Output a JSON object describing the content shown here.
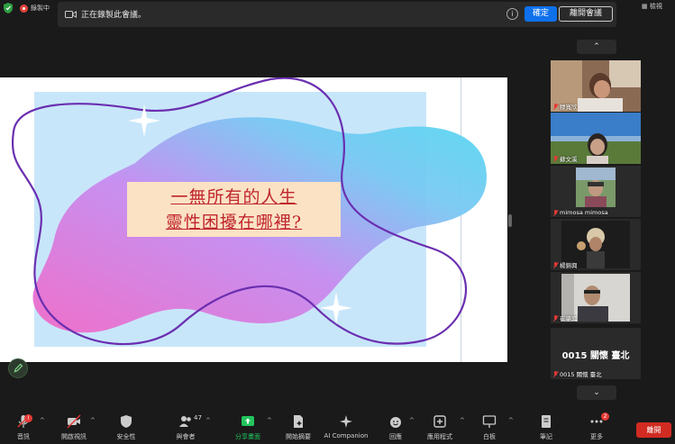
{
  "top": {
    "recording_label": "錄製中",
    "notice_text": "正在錄製此會議。",
    "ok_label": "確定",
    "leave_meeting_label": "離開會議",
    "view_label": "檢視"
  },
  "slide": {
    "title_line1": "一無所有的人生",
    "title_line2": "靈性困擾在哪裡?"
  },
  "gallery": {
    "tiles": [
      {
        "name": "穆寬欣"
      },
      {
        "name": "蘇文溪"
      },
      {
        "name": "mimosa mimosa"
      },
      {
        "name": "楊錦興"
      },
      {
        "name": "崔肇興"
      },
      {
        "name": "0015 關懷 臺北",
        "display_name": "0015 關懷 臺北"
      }
    ]
  },
  "toolbar": {
    "items": [
      {
        "label": "音訊",
        "icon": "mic-icon",
        "badge": "!"
      },
      {
        "label": "開啟視訊",
        "icon": "video-off-icon"
      },
      {
        "label": "安全性",
        "icon": "shield-icon"
      },
      {
        "label": "與會者",
        "icon": "participants-icon",
        "count": "47"
      },
      {
        "label": "分享畫面",
        "icon": "share-screen-icon"
      },
      {
        "label": "開始摘要",
        "icon": "summary-icon"
      },
      {
        "label": "AI Companion",
        "icon": "ai-companion-icon"
      },
      {
        "label": "回應",
        "icon": "reaction-icon"
      },
      {
        "label": "應用程式",
        "icon": "apps-icon"
      },
      {
        "label": "白板",
        "icon": "whiteboard-icon"
      },
      {
        "label": "筆記",
        "icon": "notes-icon"
      },
      {
        "label": "更多",
        "icon": "more-icon",
        "badge": "2"
      }
    ],
    "end_label": "離開"
  },
  "colors": {
    "accent_blue": "#0e71eb",
    "share_green": "#22c55e",
    "end_red": "#d12b22",
    "slide_title_red": "#c0262d"
  }
}
